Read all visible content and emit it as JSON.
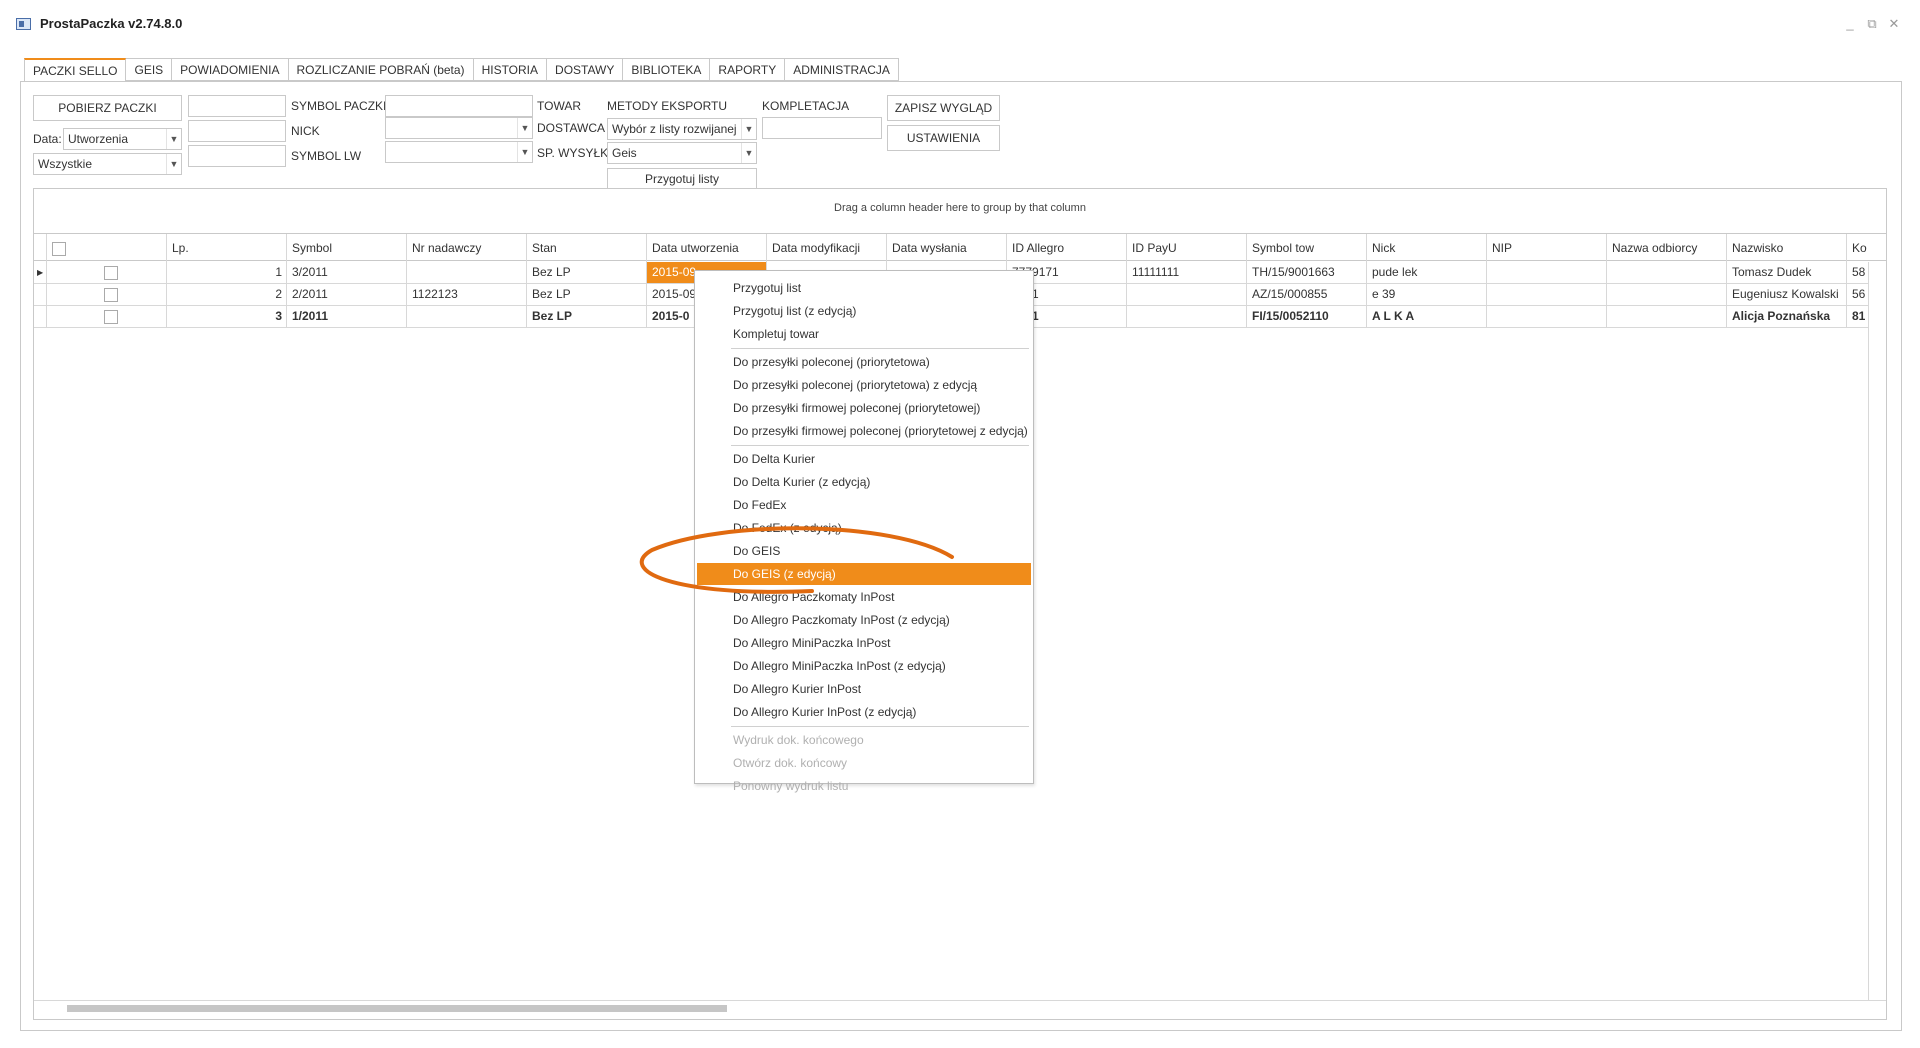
{
  "window": {
    "title": "ProstaPaczka v2.74.8.0"
  },
  "tabs": [
    "PACZKI SELLO",
    "GEIS",
    "POWIADOMIENIA",
    "ROZLICZANIE POBRAŃ (beta)",
    "HISTORIA",
    "DOSTAWY",
    "BIBLIOTEKA",
    "RAPORTY",
    "ADMINISTRACJA"
  ],
  "toolbar": {
    "pobierz": "POBIERZ PACZKI",
    "data_label": "Data:",
    "data_value": "Utworzenia",
    "status_value": "Wszystkie",
    "symbol_paczki": "SYMBOL PACZKI",
    "nick": "NICK",
    "symbol_lw": "SYMBOL LW",
    "towar": "TOWAR",
    "dostawca": "DOSTAWCA",
    "sp_wysylki": "SP. WYSYŁKI",
    "metody_eksportu": "METODY EKSPORTU",
    "metody_value": "Wybór z listy rozwijanej",
    "geis_value": "Geis",
    "przygotuj_listy": "Przygotuj listy",
    "kompletacja": "KOMPLETACJA",
    "zapisz": "ZAPISZ WYGLĄD",
    "ustawienia": "USTAWIENIA"
  },
  "grid": {
    "group_hint": "Drag a column header here to group by that column",
    "columns": [
      "Lp.",
      "Symbol",
      "Nr nadawczy",
      "Stan",
      "Data utworzenia",
      "Data modyfikacji",
      "Data wysłania",
      "ID Allegro",
      "ID PayU",
      "Symbol tow",
      "Nick",
      "NIP",
      "Nazwa odbiorcy",
      "Nazwisko",
      "Ko"
    ],
    "rows": [
      {
        "lp": "1",
        "symbol": "3/2011",
        "nr": "",
        "stan": "Bez LP",
        "data_utw": "2015-09",
        "data_mod": "",
        "allegro": "7779171",
        "payu": "11111111",
        "symbol_tow": "TH/15/9001663",
        "nick": "pude lek",
        "nazwisko": "Tomasz Dudek",
        "ko": "58"
      },
      {
        "lp": "2",
        "symbol": "2/2011",
        "nr": "1122123",
        "stan": "Bez LP",
        "data_utw": "2015-09",
        "data_mod": "",
        "allegro": "9171",
        "payu": "",
        "symbol_tow": "AZ/15/000855",
        "nick": "e 39",
        "nazwisko": "Eugeniusz Kowalski",
        "ko": "56"
      },
      {
        "lp": "3",
        "symbol": "1/2011",
        "nr": "",
        "stan": "Bez LP",
        "data_utw": "2015-0",
        "data_mod": "",
        "allegro": "9171",
        "payu": "",
        "symbol_tow": "FI/15/0052110",
        "nick": "A L K A",
        "nazwisko": "Alicja Poznańska",
        "ko": "81"
      }
    ]
  },
  "context_menu": {
    "groups": [
      [
        "Przygotuj list",
        "Przygotuj list (z edycją)",
        "Kompletuj towar"
      ],
      [
        "Do przesyłki poleconej (priorytetowa)",
        "Do przesyłki poleconej (priorytetowa) z edycją",
        "Do przesyłki firmowej poleconej (priorytetowej)",
        "Do przesyłki firmowej poleconej (priorytetowej z edycją)"
      ],
      [
        "Do Delta Kurier",
        "Do Delta Kurier (z edycją)",
        "Do FedEx",
        "Do FedEx (z edycją)",
        "Do GEIS",
        "Do GEIS (z edycją)",
        "Do Allegro Paczkomaty InPost",
        "Do Allegro Paczkomaty InPost (z edycją)",
        "Do Allegro MiniPaczka InPost",
        "Do Allegro MiniPaczka InPost (z edycją)",
        "Do Allegro Kurier InPost",
        "Do Allegro Kurier InPost (z edycją)"
      ],
      [
        "Wydruk dok. końcowego",
        "Otwórz dok. końcowy",
        "Ponowny wydruk listu"
      ]
    ],
    "highlighted": "Do GEIS (z edycją)",
    "disabled_group": 3
  },
  "colors": {
    "accent": "#f08c1a",
    "border": "#c9c9c9"
  }
}
